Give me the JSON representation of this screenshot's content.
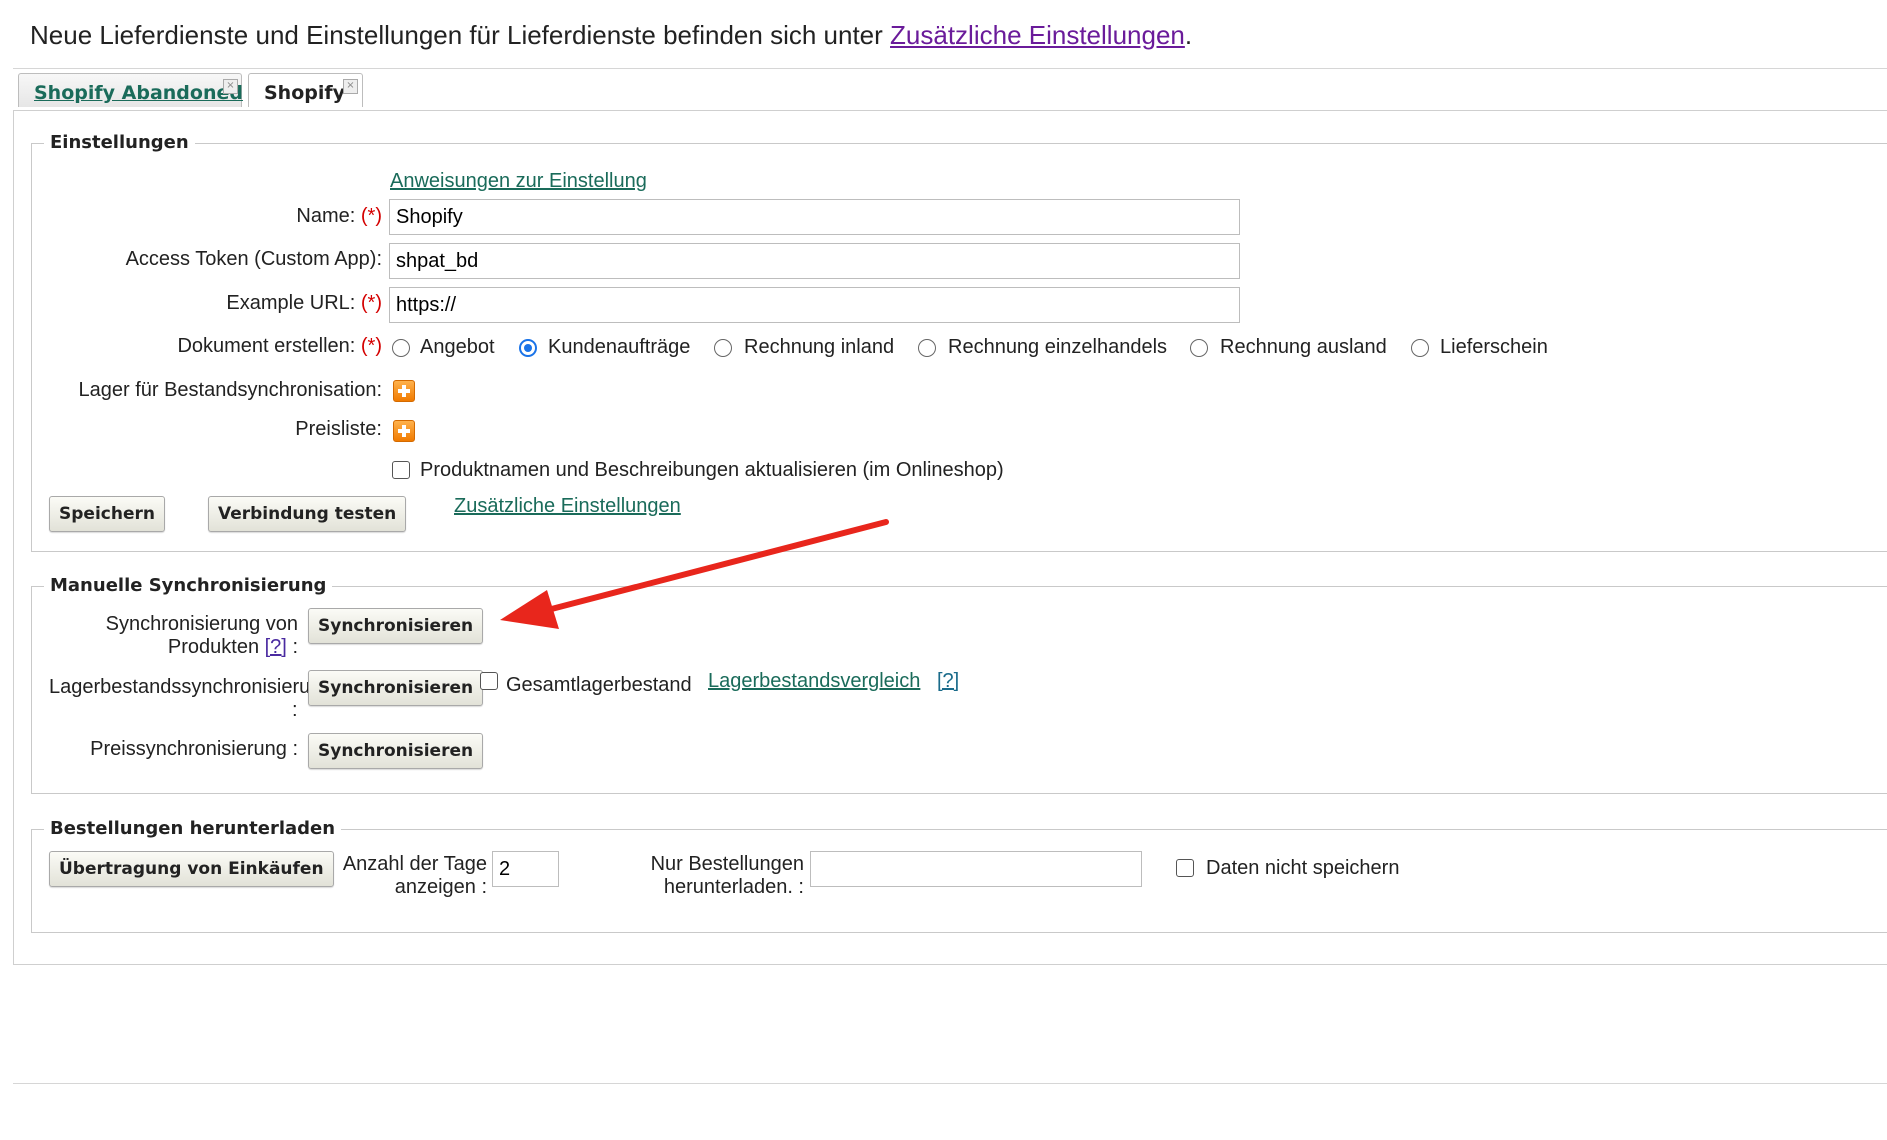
{
  "notice": {
    "text": "Neue Lieferdienste und Einstellungen für Lieferdienste befinden sich unter ",
    "link": "Zusätzliche Einstellungen",
    "end": "."
  },
  "tabs": [
    {
      "label": "Shopify Abandoned",
      "close": "×"
    },
    {
      "label": "Shopify",
      "close": "×"
    }
  ],
  "settings": {
    "legend": "Einstellungen",
    "instructions_link": "Anweisungen zur Einstellung",
    "required_mark": "(*)",
    "name_label": "Name:",
    "name_value": "Shopify",
    "token_label": "Access Token (Custom App):",
    "token_value": "shpat_bd",
    "url_label": "Example URL:",
    "url_value": "https://",
    "doc_label": "Dokument erstellen:",
    "doc_options": [
      "Angebot",
      "Kundenaufträge",
      "Rechnung inland",
      "Rechnung einzelhandels",
      "Rechnung ausland",
      "Lieferschein"
    ],
    "doc_selected": "Kundenaufträge",
    "warehouse_label": "Lager für Bestandsynchronisation:",
    "pricelist_label": "Preisliste:",
    "update_names_label": "Produktnamen und Beschreibungen aktualisieren (im Onlineshop)",
    "save_button": "Speichern",
    "test_button": "Verbindung testen",
    "extra_link": "Zusätzliche Einstellungen"
  },
  "manual_sync": {
    "legend": "Manuelle Synchronisierung",
    "products_label_1": "Synchronisierung von",
    "products_label_2": "Produkten",
    "help": "[?]",
    "colon": ":",
    "sync_button": "Synchronisieren",
    "stock_label": "Lagerbestandssynchronisierung",
    "total_stock_label": "Gesamtlagerbestand",
    "stock_compare_link": "Lagerbestandsvergleich",
    "price_label": "Preissynchronisierung :"
  },
  "orders": {
    "legend": "Bestellungen herunterladen",
    "transfer_button": "Übertragung von Einkäufen",
    "days_label_1": "Anzahl der Tage",
    "days_label_2": "anzeigen :",
    "days_value": "2",
    "only_orders_label_1": "Nur Bestellungen",
    "only_orders_label_2": "herunterladen. :",
    "only_orders_value": "",
    "no_save_label": "Daten nicht speichern"
  },
  "colors": {
    "accent_link": "#1a6b5a",
    "visited_link": "#6a1b9a",
    "required": "#d40000",
    "annotation_arrow": "#e8261c",
    "radio_selected": "#1a73e8"
  }
}
